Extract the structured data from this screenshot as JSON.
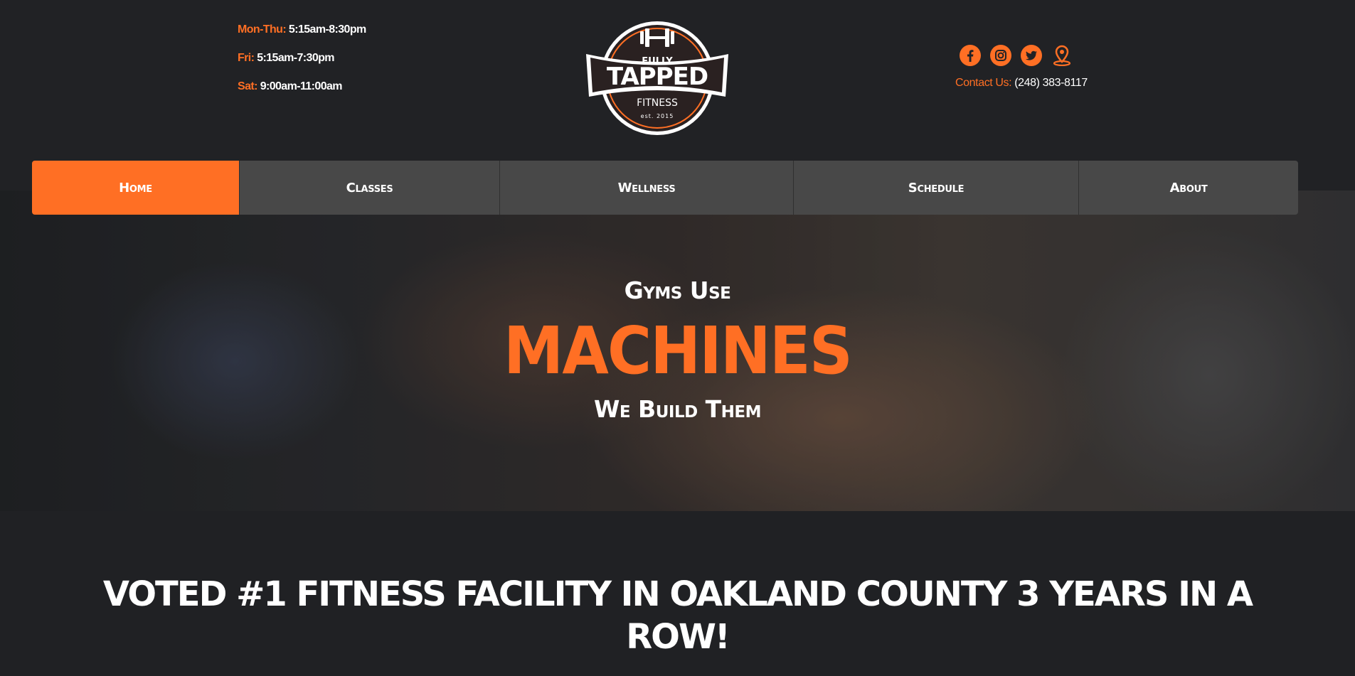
{
  "hours": [
    {
      "label": "Mon-Thu:",
      "value": "5:15am-8:30pm"
    },
    {
      "label": "Fri:",
      "value": "5:15am-7:30pm"
    },
    {
      "label": "Sat:",
      "value": "9:00am-11:00am"
    }
  ],
  "logo": {
    "line1": "FULLY",
    "line2": "TAPPED",
    "line3": "FITNESS",
    "line4": "est. 2015"
  },
  "social": {
    "icons": [
      "facebook-icon",
      "instagram-icon",
      "twitter-icon",
      "map-pin-icon"
    ]
  },
  "contact": {
    "label": "Contact Us:",
    "phone": "(248) 383-8117"
  },
  "nav": {
    "items": [
      {
        "label": "Home",
        "active": true
      },
      {
        "label": "Classes"
      },
      {
        "label": "Wellness"
      },
      {
        "label": "Schedule"
      },
      {
        "label": "About"
      }
    ]
  },
  "hero": {
    "line1": "Gyms Use",
    "headline": "MACHINES",
    "line3": "We Build Them"
  },
  "banner": {
    "line1": "VOTED #1 FITNESS FACILITY IN OAKLAND COUNTY 3 YEARS IN A",
    "line2": "ROW!"
  },
  "colors": {
    "accent": "#ff6f24",
    "background": "#202124",
    "nav": "#484848"
  }
}
